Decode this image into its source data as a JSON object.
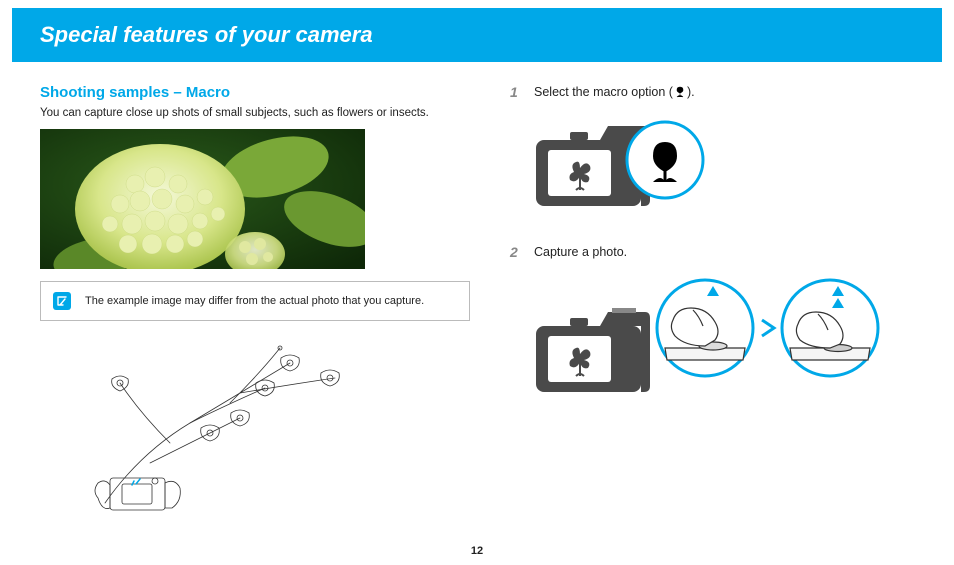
{
  "header": {
    "title": "Special features of your camera"
  },
  "left": {
    "heading": "Shooting samples – Macro",
    "intro": "You can capture close up shots of small subjects, such as flowers or insects.",
    "note": "The example image may differ from the actual photo that you capture."
  },
  "steps": [
    {
      "num": "1",
      "text_before": "Select the macro option (",
      "text_after": ")."
    },
    {
      "num": "2",
      "text_before": "Capture a photo.",
      "text_after": ""
    }
  ],
  "page_number": "12",
  "colors": {
    "accent": "#00a8e8",
    "dark": "#4a4a4a"
  }
}
